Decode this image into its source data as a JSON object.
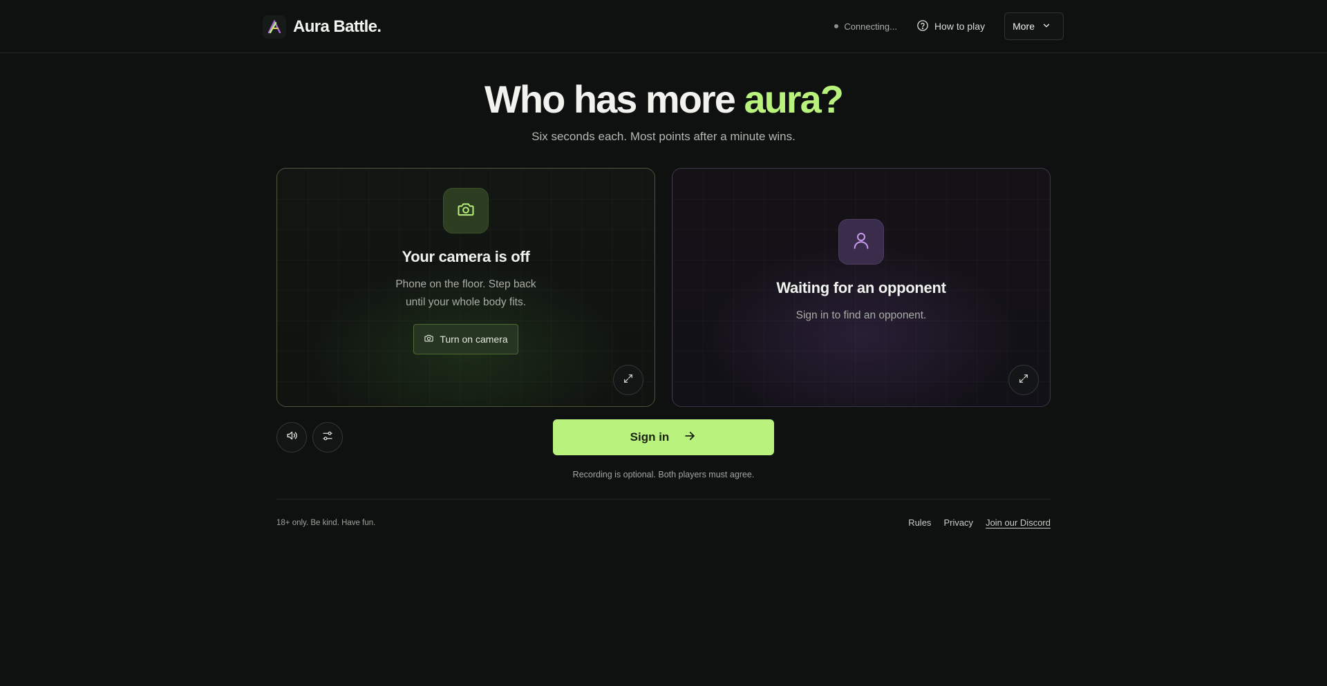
{
  "header": {
    "brand_name": "Aura Battle.",
    "status_text": "Connecting...",
    "howto_label": "How to play",
    "more_label": "More"
  },
  "hero": {
    "title_main": "Who has more ",
    "title_accent": "aura?",
    "subtitle": "Six seconds each. Most points after a minute wins."
  },
  "left_panel": {
    "icon": "camera-icon",
    "title": "Your camera is off",
    "text_line1": "Phone on the floor. Step back",
    "text_line2": "until your whole body fits.",
    "button_label": "Turn on camera"
  },
  "right_panel": {
    "icon": "user-icon",
    "title": "Waiting for an opponent",
    "text": "Sign in to find an opponent."
  },
  "controls": {
    "sound_icon": "speaker-icon",
    "settings_icon": "sliders-icon",
    "signin_label": "Sign in",
    "note": "Recording is optional. Both players must agree."
  },
  "footer": {
    "left_text": "18+ only. Be kind. Have fun.",
    "links": [
      "Rules",
      "Privacy",
      "Join our Discord"
    ]
  },
  "colors": {
    "accent": "#b9f27d",
    "background": "#0e1110",
    "green_tile": "#2c3d22",
    "purple_tile": "#3a2d4b"
  }
}
